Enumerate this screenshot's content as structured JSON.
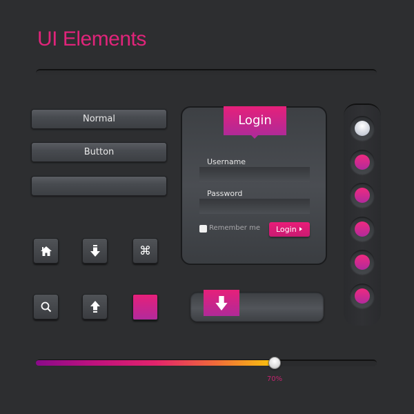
{
  "header": {
    "title": "UI Elements"
  },
  "buttons": [
    {
      "label": "Normal"
    },
    {
      "label": "Button"
    },
    {
      "label": ""
    }
  ],
  "icon_buttons": [
    {
      "icon": "home-icon"
    },
    {
      "icon": "download-arrow-icon"
    },
    {
      "icon": "command-icon",
      "glyph": "⌘"
    },
    {
      "icon": "search-icon"
    },
    {
      "icon": "upload-arrow-icon"
    },
    {
      "icon": "pink-square"
    }
  ],
  "login": {
    "title": "Login",
    "username_label": "Username",
    "username_value": "",
    "password_label": "Password",
    "password_value": "",
    "remember_label": "Remember me",
    "remember_checked": false,
    "submit_label": "Login"
  },
  "radio_group": {
    "options": 6,
    "selected_index": 0
  },
  "toggle": {
    "icon": "download-arrow-icon",
    "state": "off"
  },
  "slider": {
    "value_percent": 70,
    "label": "70%"
  },
  "colors": {
    "accent": "#e6207a",
    "accent_dark": "#b02a98",
    "background": "#2d2e30"
  }
}
